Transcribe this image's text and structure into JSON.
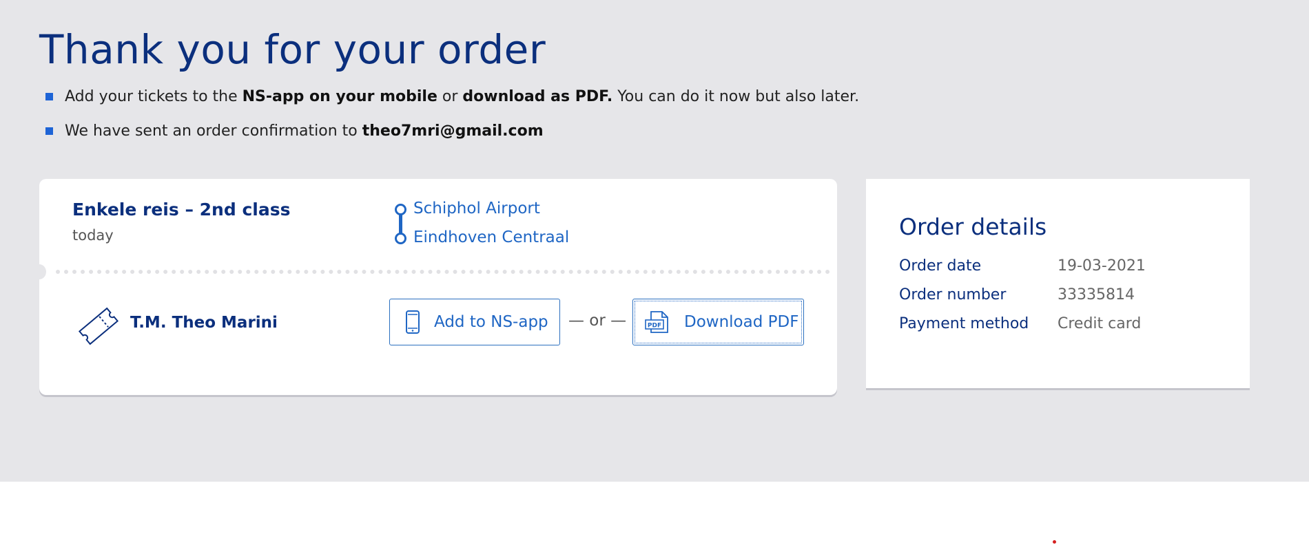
{
  "header": {
    "title": "Thank you for your order",
    "bullet1": {
      "t1": "Add your tickets to the ",
      "b1": "NS-app on your mobile",
      "t2": " or ",
      "b2": "download as PDF.",
      "t3": " You can do it now but also later."
    },
    "bullet2": {
      "t1": "We have sent an order confirmation to ",
      "email": "theo7mri@gmail.com"
    }
  },
  "ticket": {
    "title": "Enkele reis – 2nd class",
    "date": "today",
    "from": "Schiphol Airport",
    "to": "Eindhoven Centraal",
    "passenger": "T.M. Theo Marini",
    "add_app_label": "Add to NS-app",
    "or_label": "— or —",
    "download_label": "Download PDF"
  },
  "order_details": {
    "title": "Order details",
    "rows": [
      {
        "label": "Order date",
        "value": "19-03-2021"
      },
      {
        "label": "Order number",
        "value": "33335814"
      },
      {
        "label": "Payment method",
        "value": "Credit card"
      }
    ]
  },
  "icons": {
    "ticket": "ticket-icon",
    "phone": "phone-icon",
    "pdf": "pdf-icon"
  },
  "colors": {
    "accent": "#1f66c4",
    "heading": "#0b2f7d",
    "background": "#e6e6e9"
  }
}
